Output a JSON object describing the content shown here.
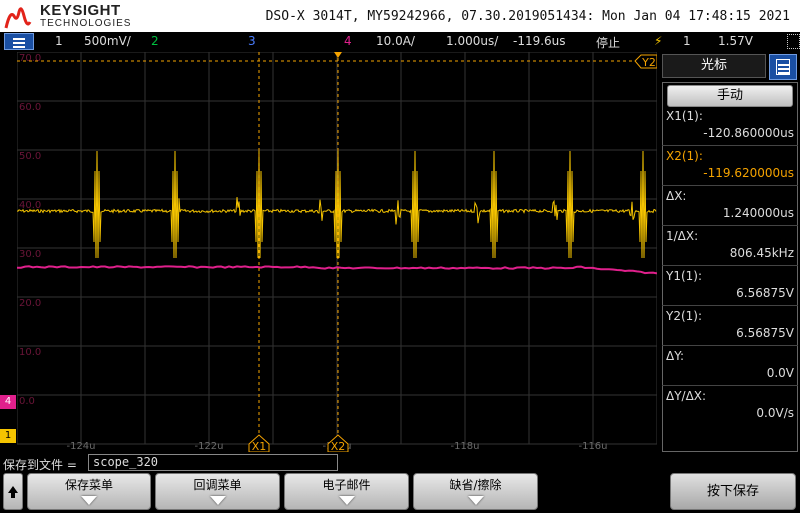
{
  "header": {
    "brand": "KEYSIGHT",
    "brand_sub": "TECHNOLOGIES",
    "info": "DSO-X 3014T, MY59242966, 07.30.2019051434: Mon Jan 04 17:48:15 2021"
  },
  "status": {
    "ch1_num": "1",
    "ch1_scale": "500mV/",
    "ch2_num": "2",
    "ch3_num": "3",
    "ch4_num": "4",
    "ch4_scale": "10.0A/",
    "timebase": "1.000us/",
    "delay": "-119.6us",
    "run_state": "停止",
    "trig_source": "1",
    "trig_level": "1.57V",
    "colors": {
      "ch1": "#f5c400",
      "ch2": "#00c040",
      "ch3": "#4a7dff",
      "ch4": "#e0208c"
    }
  },
  "display": {
    "y_labels": [
      "70.0",
      "60.0",
      "50.0",
      "40.0",
      "30.0",
      "20.0",
      "10.0",
      "0.0"
    ],
    "x_labels": [
      "-124u",
      "-122u",
      "-120u",
      "-118u",
      "-116u"
    ],
    "cursor_x1": "X1",
    "cursor_x2": "X2",
    "cursor_y2": "Y2",
    "ch4_marker": "4",
    "ch1_marker": "1"
  },
  "panel": {
    "title": "光标",
    "mode_button": "手动",
    "rows": [
      {
        "label": "X1(1):",
        "value": "-120.860000us",
        "label_color": "#dddddd"
      },
      {
        "label": "X2(1):",
        "value": "-119.620000us",
        "label_color": "#f5a300"
      },
      {
        "label": "ΔX:",
        "value": "1.240000us",
        "label_color": "#dddddd"
      },
      {
        "label": "1/ΔX:",
        "value": "806.45kHz",
        "label_color": "#dddddd"
      },
      {
        "label": "Y1(1):",
        "value": "6.56875V",
        "label_color": "#dddddd"
      },
      {
        "label": "Y2(1):",
        "value": "6.56875V",
        "label_color": "#dddddd"
      },
      {
        "label": "ΔY:",
        "value": "0.0V",
        "label_color": "#dddddd"
      },
      {
        "label": "ΔY/ΔX:",
        "value": "0.0V/s",
        "label_color": "#dddddd"
      }
    ]
  },
  "bottom": {
    "save_to_file_label": "保存到文件 =",
    "filename": "scope_320",
    "softkeys": [
      "保存菜单",
      "回调菜单",
      "电子邮件",
      "缺省/擦除"
    ],
    "press_save": "按下保存"
  }
}
